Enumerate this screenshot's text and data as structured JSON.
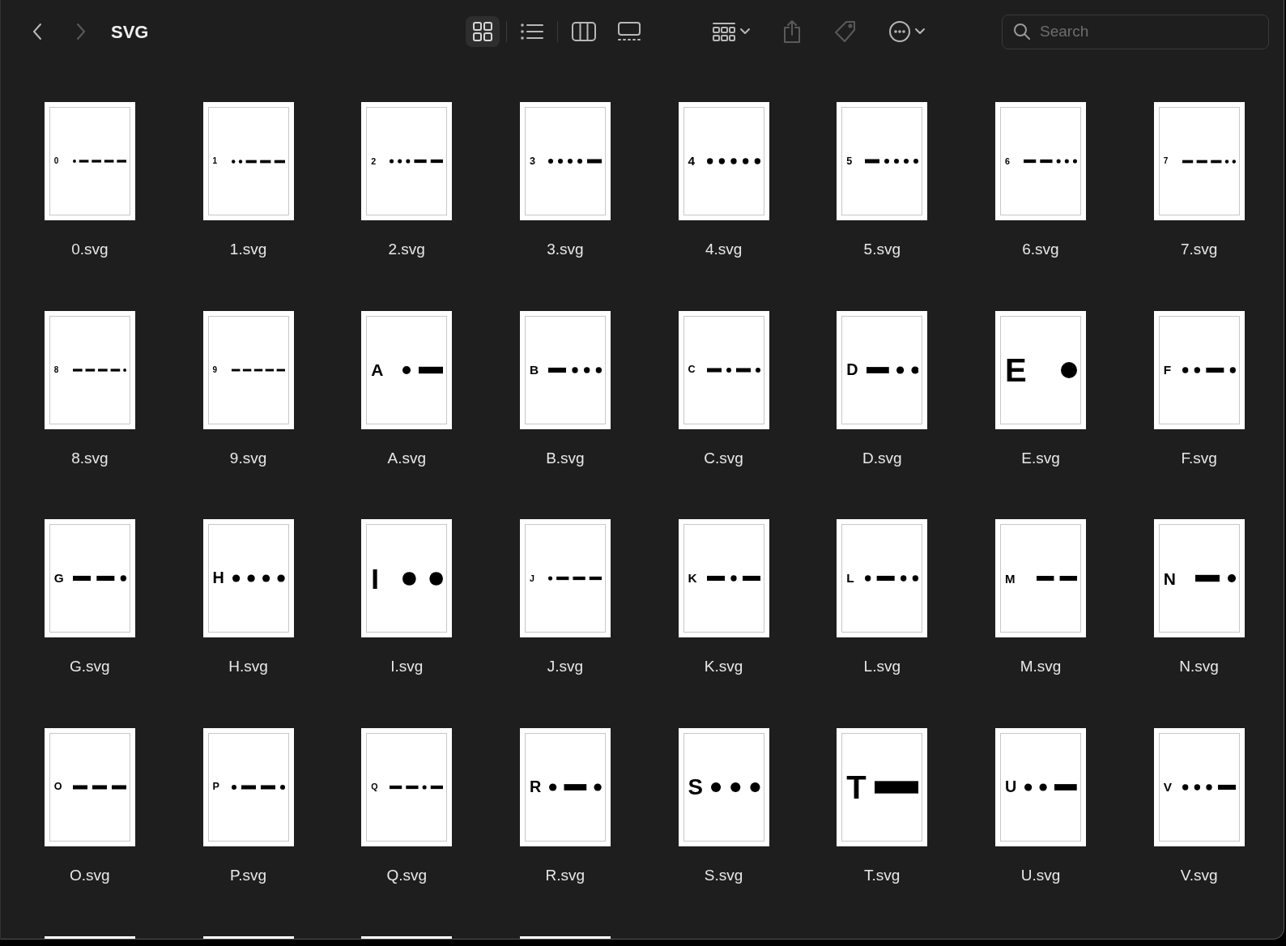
{
  "window": {
    "title": "SVG"
  },
  "navigation": [
    {
      "kind": "back",
      "disabled": false
    },
    {
      "kind": "forward",
      "disabled": true
    }
  ],
  "views": [
    {
      "kind": "icons",
      "selected": true
    },
    {
      "kind": "list",
      "selected": false
    },
    {
      "kind": "columns",
      "selected": false
    },
    {
      "kind": "gallery",
      "selected": false
    }
  ],
  "actions": [
    {
      "kind": "group",
      "disabled": false
    },
    {
      "kind": "share",
      "disabled": true
    },
    {
      "kind": "tag",
      "disabled": true
    },
    {
      "kind": "more",
      "disabled": false
    }
  ],
  "search": {
    "placeholder": "Search"
  },
  "files": [
    {
      "name": "0.svg",
      "glyph": "0",
      "symbols": [
        {
          "kind": "dot"
        },
        {
          "kind": "dash"
        },
        {
          "kind": "dash"
        },
        {
          "kind": "dash"
        },
        {
          "kind": "dash"
        }
      ]
    },
    {
      "name": "1.svg",
      "glyph": "1",
      "symbols": [
        {
          "kind": "dot"
        },
        {
          "kind": "dot"
        },
        {
          "kind": "dash"
        },
        {
          "kind": "dash"
        },
        {
          "kind": "dash"
        }
      ]
    },
    {
      "name": "2.svg",
      "glyph": "2",
      "symbols": [
        {
          "kind": "dot"
        },
        {
          "kind": "dot"
        },
        {
          "kind": "dot"
        },
        {
          "kind": "dash"
        },
        {
          "kind": "dash"
        }
      ]
    },
    {
      "name": "3.svg",
      "glyph": "3",
      "symbols": [
        {
          "kind": "dot"
        },
        {
          "kind": "dot"
        },
        {
          "kind": "dot"
        },
        {
          "kind": "dot"
        },
        {
          "kind": "dash"
        }
      ]
    },
    {
      "name": "4.svg",
      "glyph": "4",
      "symbols": [
        {
          "kind": "dot"
        },
        {
          "kind": "dot"
        },
        {
          "kind": "dot"
        },
        {
          "kind": "dot"
        },
        {
          "kind": "dot"
        }
      ]
    },
    {
      "name": "5.svg",
      "glyph": "5",
      "symbols": [
        {
          "kind": "dash"
        },
        {
          "kind": "dot"
        },
        {
          "kind": "dot"
        },
        {
          "kind": "dot"
        },
        {
          "kind": "dot"
        }
      ]
    },
    {
      "name": "6.svg",
      "glyph": "6",
      "symbols": [
        {
          "kind": "dash"
        },
        {
          "kind": "dash"
        },
        {
          "kind": "dot"
        },
        {
          "kind": "dot"
        },
        {
          "kind": "dot"
        }
      ]
    },
    {
      "name": "7.svg",
      "glyph": "7",
      "symbols": [
        {
          "kind": "dash"
        },
        {
          "kind": "dash"
        },
        {
          "kind": "dash"
        },
        {
          "kind": "dot"
        },
        {
          "kind": "dot"
        }
      ]
    },
    {
      "name": "8.svg",
      "glyph": "8",
      "symbols": [
        {
          "kind": "dash"
        },
        {
          "kind": "dash"
        },
        {
          "kind": "dash"
        },
        {
          "kind": "dash"
        },
        {
          "kind": "dot"
        }
      ]
    },
    {
      "name": "9.svg",
      "glyph": "9",
      "symbols": [
        {
          "kind": "dash"
        },
        {
          "kind": "dash"
        },
        {
          "kind": "dash"
        },
        {
          "kind": "dash"
        },
        {
          "kind": "dash"
        }
      ]
    },
    {
      "name": "A.svg",
      "glyph": "A",
      "symbols": [
        {
          "kind": "dot"
        },
        {
          "kind": "dash"
        }
      ]
    },
    {
      "name": "B.svg",
      "glyph": "B",
      "symbols": [
        {
          "kind": "dash"
        },
        {
          "kind": "dot"
        },
        {
          "kind": "dot"
        },
        {
          "kind": "dot"
        }
      ]
    },
    {
      "name": "C.svg",
      "glyph": "C",
      "symbols": [
        {
          "kind": "dash"
        },
        {
          "kind": "dot"
        },
        {
          "kind": "dash"
        },
        {
          "kind": "dot"
        }
      ]
    },
    {
      "name": "D.svg",
      "glyph": "D",
      "symbols": [
        {
          "kind": "dash"
        },
        {
          "kind": "dot"
        },
        {
          "kind": "dot"
        }
      ]
    },
    {
      "name": "E.svg",
      "glyph": "E",
      "symbols": [
        {
          "kind": "dot"
        }
      ]
    },
    {
      "name": "F.svg",
      "glyph": "F",
      "symbols": [
        {
          "kind": "dot"
        },
        {
          "kind": "dot"
        },
        {
          "kind": "dash"
        },
        {
          "kind": "dot"
        }
      ]
    },
    {
      "name": "G.svg",
      "glyph": "G",
      "symbols": [
        {
          "kind": "dash"
        },
        {
          "kind": "dash"
        },
        {
          "kind": "dot"
        }
      ]
    },
    {
      "name": "H.svg",
      "glyph": "H",
      "symbols": [
        {
          "kind": "dot"
        },
        {
          "kind": "dot"
        },
        {
          "kind": "dot"
        },
        {
          "kind": "dot"
        }
      ]
    },
    {
      "name": "I.svg",
      "glyph": "I",
      "symbols": [
        {
          "kind": "dot"
        },
        {
          "kind": "dot"
        }
      ]
    },
    {
      "name": "J.svg",
      "glyph": "J",
      "symbols": [
        {
          "kind": "dot"
        },
        {
          "kind": "dash"
        },
        {
          "kind": "dash"
        },
        {
          "kind": "dash"
        }
      ]
    },
    {
      "name": "K.svg",
      "glyph": "K",
      "symbols": [
        {
          "kind": "dash"
        },
        {
          "kind": "dot"
        },
        {
          "kind": "dash"
        }
      ]
    },
    {
      "name": "L.svg",
      "glyph": "L",
      "symbols": [
        {
          "kind": "dot"
        },
        {
          "kind": "dash"
        },
        {
          "kind": "dot"
        },
        {
          "kind": "dot"
        }
      ]
    },
    {
      "name": "M.svg",
      "glyph": "M",
      "symbols": [
        {
          "kind": "dash"
        },
        {
          "kind": "dash"
        }
      ]
    },
    {
      "name": "N.svg",
      "glyph": "N",
      "symbols": [
        {
          "kind": "dash"
        },
        {
          "kind": "dot"
        }
      ]
    },
    {
      "name": "O.svg",
      "glyph": "O",
      "symbols": [
        {
          "kind": "dash"
        },
        {
          "kind": "dash"
        },
        {
          "kind": "dash"
        }
      ]
    },
    {
      "name": "P.svg",
      "glyph": "P",
      "symbols": [
        {
          "kind": "dot"
        },
        {
          "kind": "dash"
        },
        {
          "kind": "dash"
        },
        {
          "kind": "dot"
        }
      ]
    },
    {
      "name": "Q.svg",
      "glyph": "Q",
      "symbols": [
        {
          "kind": "dash"
        },
        {
          "kind": "dash"
        },
        {
          "kind": "dot"
        },
        {
          "kind": "dash"
        }
      ]
    },
    {
      "name": "R.svg",
      "glyph": "R",
      "symbols": [
        {
          "kind": "dot"
        },
        {
          "kind": "dash"
        },
        {
          "kind": "dot"
        }
      ]
    },
    {
      "name": "S.svg",
      "glyph": "S",
      "symbols": [
        {
          "kind": "dot"
        },
        {
          "kind": "dot"
        },
        {
          "kind": "dot"
        }
      ]
    },
    {
      "name": "T.svg",
      "glyph": "T",
      "symbols": [
        {
          "kind": "dash"
        }
      ]
    },
    {
      "name": "U.svg",
      "glyph": "U",
      "symbols": [
        {
          "kind": "dot"
        },
        {
          "kind": "dot"
        },
        {
          "kind": "dash"
        }
      ]
    },
    {
      "name": "V.svg",
      "glyph": "V",
      "symbols": [
        {
          "kind": "dot"
        },
        {
          "kind": "dot"
        },
        {
          "kind": "dot"
        },
        {
          "kind": "dash"
        }
      ]
    }
  ],
  "cut_files": [
    {
      "kind": "file"
    },
    {
      "kind": "file"
    },
    {
      "kind": "file"
    },
    {
      "kind": "file"
    }
  ]
}
